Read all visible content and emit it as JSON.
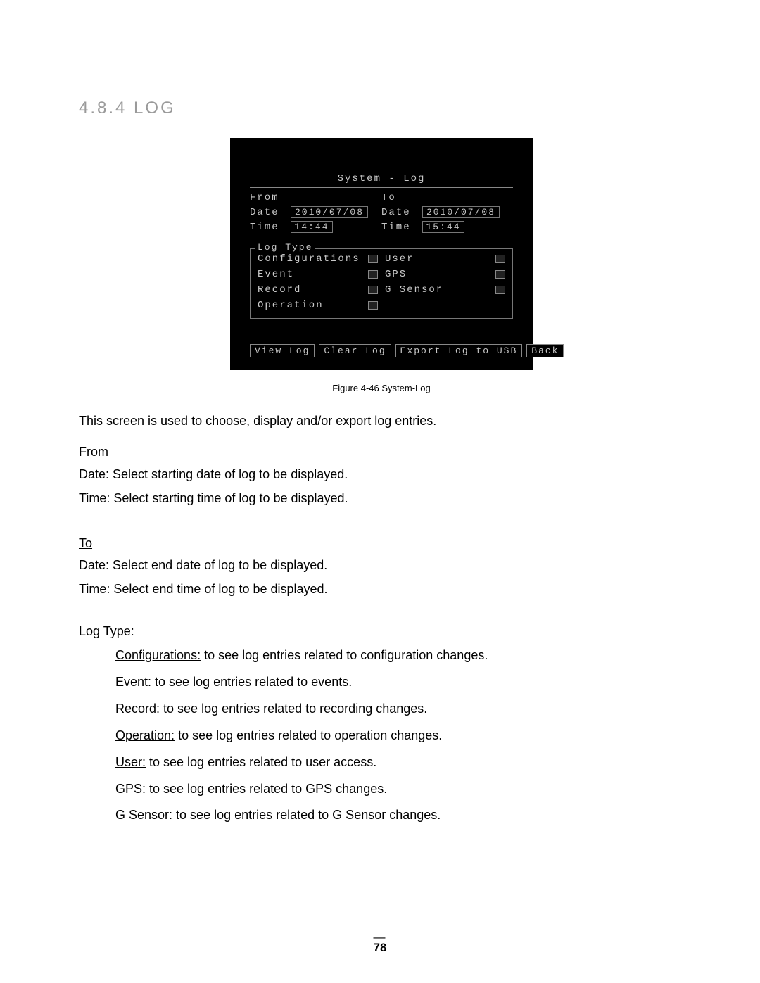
{
  "heading": "4.8.4 LOG",
  "screenshot": {
    "title": "System - Log",
    "from": {
      "label": "From",
      "date_label": "Date",
      "date": "2010/07/08",
      "time_label": "Time",
      "time": "14:44"
    },
    "to": {
      "label": "To",
      "date_label": "Date",
      "date": "2010/07/08",
      "time_label": "Time",
      "time": "15:44"
    },
    "logtype_label": "Log Type",
    "types": {
      "configurations": "Configurations",
      "event": "Event",
      "record": "Record",
      "operation": "Operation",
      "user": "User",
      "gps": "GPS",
      "gsensor": "G Sensor"
    },
    "buttons": {
      "view": "View Log",
      "clear": "Clear Log",
      "export": "Export Log to USB",
      "back": "Back"
    }
  },
  "caption": "Figure 4-46 System-Log",
  "intro": "This screen is used to choose, display and/or export log entries.",
  "from_section": {
    "title": "From",
    "date_label": "Date:",
    "date_text": " Select starting date of log to be displayed.",
    "time_label": "Time:",
    "time_text": " Select starting time of log to be displayed."
  },
  "to_section": {
    "title": "To",
    "date_label": "Date:",
    "date_text": " Select end date of log to be displayed.",
    "time_label": "Time:",
    "time_text": " Select end time of log to be displayed."
  },
  "logtype_section": {
    "title": "Log Type:",
    "items": {
      "configurations": {
        "name": "Configurations:",
        "text": " to see log entries related to configuration changes."
      },
      "event": {
        "name": "Event:",
        "text": " to see log entries related to events."
      },
      "record": {
        "name": "Record:",
        "text": " to see log entries related to recording changes."
      },
      "operation": {
        "name": "Operation:",
        "text": " to see log entries related to operation changes."
      },
      "user": {
        "name": "User:",
        "text": " to see log entries related to user access."
      },
      "gps": {
        "name": "GPS:",
        "text": " to see log entries related to GPS changes."
      },
      "gsensor": {
        "name": "G Sensor:",
        "text": " to see log entries related to G Sensor changes."
      }
    }
  },
  "page_number": "78"
}
